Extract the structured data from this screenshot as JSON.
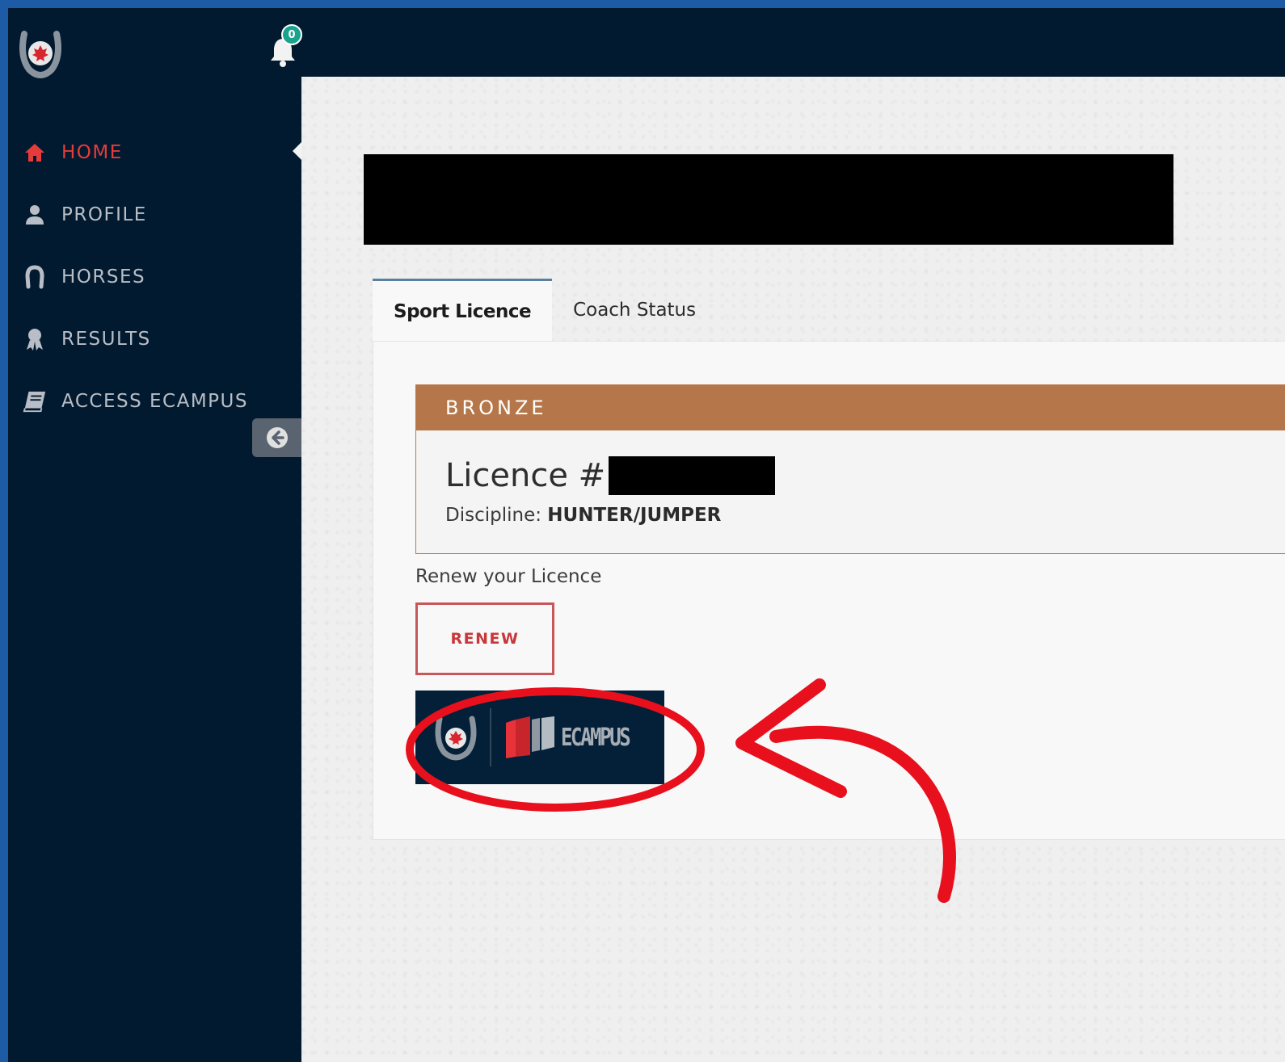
{
  "notifications": {
    "count": "0"
  },
  "sidebar": {
    "items": [
      {
        "label": "HOME",
        "icon": "home-icon",
        "active": true
      },
      {
        "label": "PROFILE",
        "icon": "user-icon",
        "active": false
      },
      {
        "label": "HORSES",
        "icon": "horseshoe-icon",
        "active": false
      },
      {
        "label": "RESULTS",
        "icon": "award-icon",
        "active": false
      },
      {
        "label": "ACCESS ECAMPUS",
        "icon": "book-icon",
        "active": false
      }
    ],
    "collapse_icon": "arrow-left-circle-icon"
  },
  "tabs": [
    {
      "label": "Sport Licence",
      "active": true
    },
    {
      "label": "Coach Status",
      "active": false
    }
  ],
  "licence": {
    "level": "BRONZE",
    "number_label": "Licence #",
    "discipline_label": "Discipline:",
    "discipline_value": "HUNTER/JUMPER"
  },
  "renew": {
    "prompt": "Renew your Licence",
    "button_label": "RENEW"
  },
  "ecampus": {
    "label": "ECAMPUS"
  },
  "colors": {
    "sidebar_bg": "#021a2f",
    "active_nav": "#e53b3b",
    "bronze": "#b57749",
    "renew_red": "#c7373b",
    "annotation_red": "#e8101c",
    "frame_blue": "#1d5ba7"
  }
}
